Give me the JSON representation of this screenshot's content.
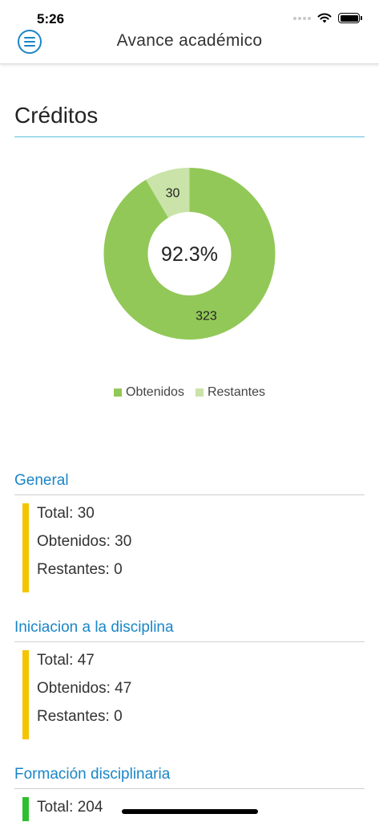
{
  "status_bar": {
    "time": "5:26"
  },
  "header": {
    "title": "Avance académico"
  },
  "section": {
    "title": "Créditos"
  },
  "chart_data": {
    "type": "pie",
    "categories": [
      "Obtenidos",
      "Restantes"
    ],
    "values": [
      323,
      30
    ],
    "labels": [
      "323",
      "30"
    ],
    "center_label": "92.3%",
    "colors": [
      "#92c857",
      "#c9e3a8"
    ],
    "legend": [
      "Obtenidos",
      "Restantes"
    ],
    "legend_position": "bottom"
  },
  "groups": [
    {
      "title": "General",
      "bar_color": "#f5c400",
      "lines": [
        "Total: 30",
        "Obtenidos: 30",
        "Restantes: 0"
      ]
    },
    {
      "title": "Iniciacion a la disciplina",
      "bar_color": "#f5c400",
      "lines": [
        "Total: 47",
        "Obtenidos: 47",
        "Restantes: 0"
      ]
    },
    {
      "title": "Formación disciplinaria",
      "bar_color": "#2ebf2e",
      "lines": [
        "Total: 204"
      ]
    }
  ]
}
